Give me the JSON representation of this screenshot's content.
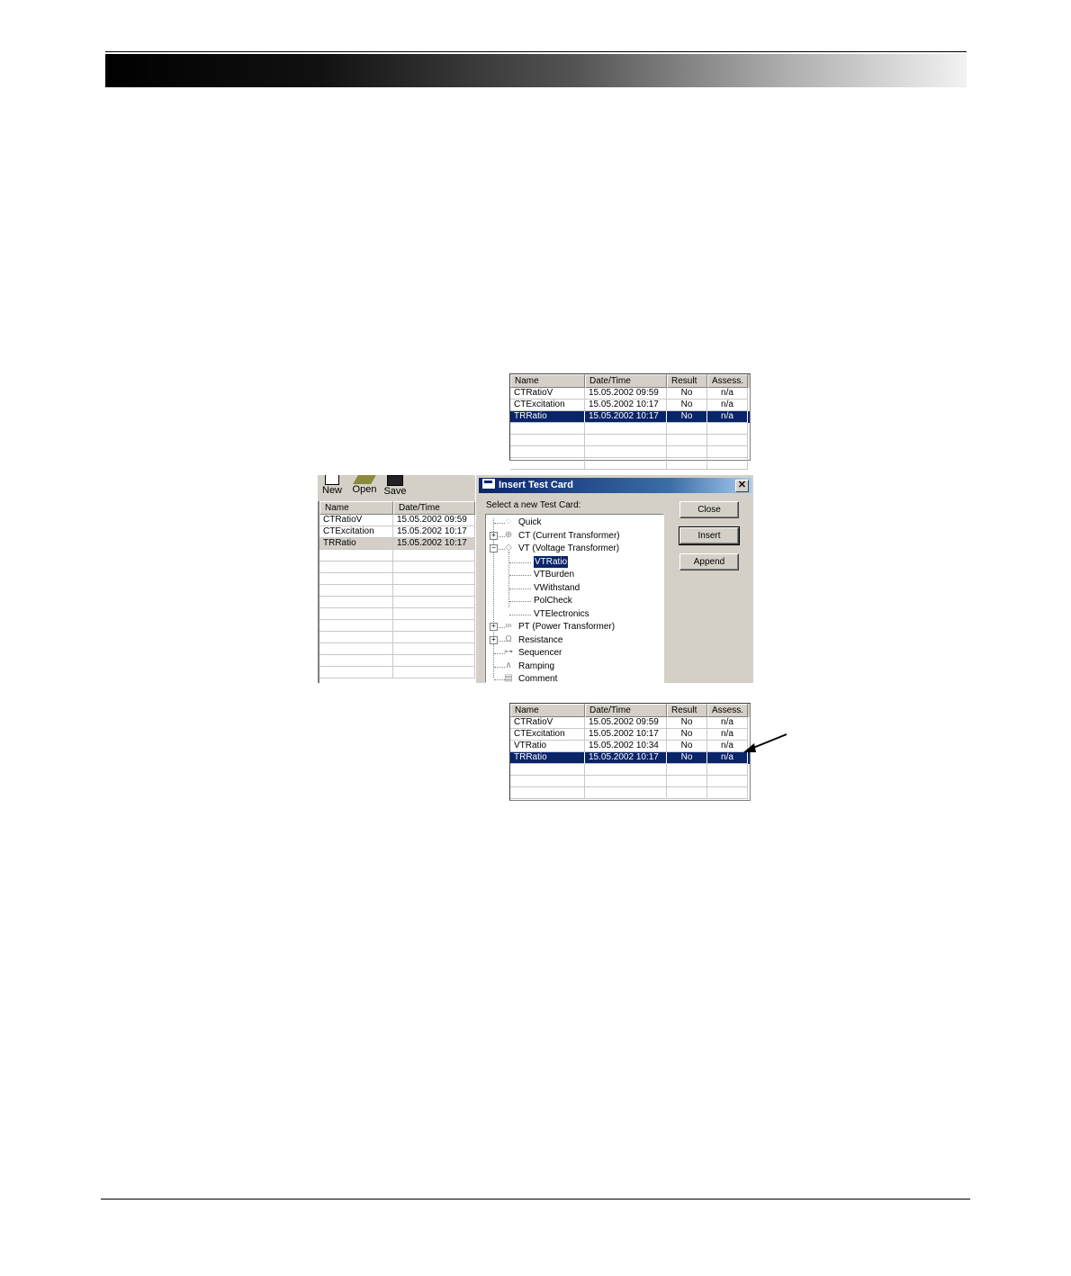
{
  "table_before": {
    "columns": [
      "Name",
      "Date/Time",
      "Result",
      "Assess."
    ],
    "rows": [
      [
        "CTRatioV",
        "15.05.2002 09:59",
        "No",
        "n/a"
      ],
      [
        "CTExcitation",
        "15.05.2002 10:17",
        "No",
        "n/a"
      ],
      [
        "TRRatio",
        "15.05.2002 10:17",
        "No",
        "n/a"
      ]
    ],
    "selected_row": 2,
    "empty_rows": 4
  },
  "toolbar": {
    "new_label": "New",
    "open_label": "Open",
    "save_label": "Save"
  },
  "left_list": {
    "columns": [
      "Name",
      "Date/Time"
    ],
    "rows": [
      [
        "CTRatioV",
        "15.05.2002 09:59"
      ],
      [
        "CTExcitation",
        "15.05.2002 10:17"
      ],
      [
        "TRRatio",
        "15.05.2002 10:17"
      ]
    ],
    "empty_rows": 11
  },
  "dialog": {
    "title": "Insert Test Card",
    "close_glyph": "✕",
    "prompt": "Select a new Test Card:",
    "tree": [
      {
        "label": "Quick",
        "level": 0,
        "expander": "",
        "icon": "quick-icon"
      },
      {
        "label": "CT (Current Transformer)",
        "level": 0,
        "expander": "+",
        "icon": "ct-icon"
      },
      {
        "label": "VT (Voltage Transformer)",
        "level": 0,
        "expander": "−",
        "icon": "vt-icon"
      },
      {
        "label": "VTRatio",
        "level": 1,
        "selected": true
      },
      {
        "label": "VTBurden",
        "level": 1
      },
      {
        "label": "VWithstand",
        "level": 1
      },
      {
        "label": "PolCheck",
        "level": 1
      },
      {
        "label": "VTElectronics",
        "level": 1
      },
      {
        "label": "PT (Power Transformer)",
        "level": 0,
        "expander": "+",
        "icon": "pt-icon"
      },
      {
        "label": "Resistance",
        "level": 0,
        "expander": "+",
        "icon": "resistance-icon"
      },
      {
        "label": "Sequencer",
        "level": 0,
        "expander": "",
        "icon": "sequencer-icon"
      },
      {
        "label": "Ramping",
        "level": 0,
        "expander": "",
        "icon": "ramping-icon"
      },
      {
        "label": "Comment",
        "level": 0,
        "expander": "",
        "icon": "comment-icon"
      }
    ],
    "buttons": {
      "close_label": "Close",
      "insert_label": "Insert",
      "append_label": "Append"
    }
  },
  "table_after": {
    "columns": [
      "Name",
      "Date/Time",
      "Result",
      "Assess."
    ],
    "rows": [
      [
        "CTRatioV",
        "15.05.2002 09:59",
        "No",
        "n/a"
      ],
      [
        "CTExcitation",
        "15.05.2002 10:17",
        "No",
        "n/a"
      ],
      [
        "VTRatio",
        "15.05.2002 10:34",
        "No",
        "n/a"
      ],
      [
        "TRRatio",
        "15.05.2002 10:17",
        "No",
        "n/a"
      ]
    ],
    "selected_row": 3,
    "empty_rows": 3
  },
  "colors": {
    "selection": "#0a246a",
    "dialog_face": "#d4d0c8"
  }
}
